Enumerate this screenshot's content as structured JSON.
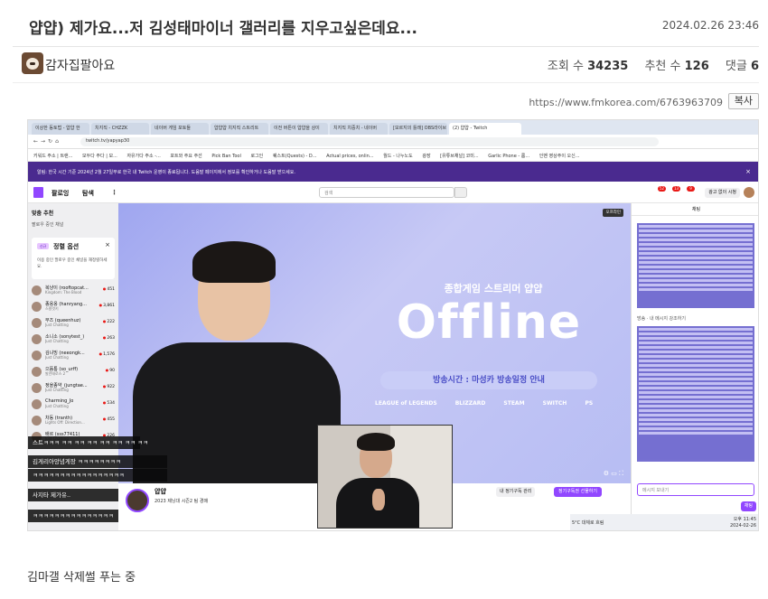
{
  "post": {
    "title": "얍얍) 제가요...저 김성태마이너 갤러리를 지우고싶은데요...",
    "date": "2024.02.26 23:46",
    "author": "감자집팔아요",
    "views_label": "조회 수",
    "views": "34235",
    "recommend_label": "추천 수",
    "recommend": "126",
    "comments_label": "댓글",
    "comments": "6",
    "url": "https://www.fmkorea.com/6763963709",
    "copy_label": "복사",
    "caption": "김마갤 삭제썰 푸는 중"
  },
  "browser": {
    "tabs": [
      "이상한 동토법 - 얍얍 한",
      "치지직 - CHZZK",
      "네이버 게임 포토들",
      "얍얍얍 치지직 스트리트",
      "이전 버튼이 얍얍을 상이",
      "치지직 치중치 - 네이버",
      "[모르지의 틀래] OBS라이브",
      "(2) 얍얍 - Twitch"
    ],
    "url": "twitch.tv/yapyap30",
    "bookmarks": [
      "키워드 주소 | 트랜...",
      "모두다 주다 | 모...",
      "자유가다 주소 -...",
      "포트와 주요 주선",
      "Pick Ban Tool",
      "로그인",
      "퀘스트(Quests) - D...",
      "Actual prices, onlin...",
      "월드 - 나누노도",
      "광장",
      "[유튜브채널] 코미...",
      "Garlic Phone - 룸...",
      "인벤 영상주이 오신..."
    ]
  },
  "twitch": {
    "notice": "알림: 한국 시간 기준 2024년 2월 27일부로 한국 내 Twitch 운영이 종료됩니다. 도움말 페이지에서 정보를 확인하거나 도움말 받으세요.",
    "nav_following": "팔로잉",
    "nav_browse": "탐색",
    "search_placeholder": "검색",
    "ad_free": "광고 없이 시청",
    "notif_counts": [
      "52",
      "13",
      "9"
    ],
    "sidebar_title": "맞춤 추천",
    "sidebar_sub": "팔로우 중인 채널",
    "card_tag": "신규",
    "card_title": "정렬 옵션",
    "card_desc": "이용 중인 팔로우 중인 채널을 재정렬하세요.",
    "channels": [
      {
        "name": "복냥이 (rooftopcat...",
        "game": "Kingdom: The Blood",
        "viewers": "451"
      },
      {
        "name": "종옹옹 (hanryang...",
        "game": "스팔럿키",
        "viewers": "3,861"
      },
      {
        "name": "무즈 (queenhuz)",
        "game": "Just Chatting",
        "viewers": "222"
      },
      {
        "name": "소니소 (sonytest_)",
        "game": "Just Chatting",
        "viewers": "263"
      },
      {
        "name": "김냐빙 (neeongk...",
        "game": "Just Chatting",
        "viewers": "1,576"
      },
      {
        "name": "으뜸통 (so_urff)",
        "game": "발란태로스 2",
        "viewers": "90"
      },
      {
        "name": "정을종약_(jungtae...",
        "game": "Just Chatting",
        "viewers": "922"
      },
      {
        "name": "Charming_Jo",
        "game": "Just Chatting",
        "viewers": "534"
      },
      {
        "name": "차동 (tranth)",
        "game": "Lights Off: Direction...",
        "viewers": "455"
      },
      {
        "name": "배르 (sss77411)",
        "game": "Just Chatting",
        "viewers": "226"
      }
    ],
    "offline_label": "오프라인",
    "headline": "종합게임 스트리머 얍얍",
    "offline_text": "Offline",
    "schedule": "방송시간 : 마성카 방송일정 안내",
    "platform_logos": [
      "LEAGUE of LEGENDS",
      "BLIZZARD",
      "STEAM",
      "SWITCH",
      "PS"
    ],
    "chat_overlays": [
      "스트ㅋㅋㅋ ㅋㅋ ㅋㅋ ㅋㅋ ㅋㅋ ㅋㅋ ㅋㅋ ㅋㅋ",
      "김게리아앙념게장 ㅋㅋㅋㅋㅋㅋㅋㅋ",
      "ㅋㅋㅋㅋㅋㅋㅋㅋㅋㅋㅋㅋㅋㅋㅋㅋㅋ",
      "사지타 제가유..",
      "ㅋㅋㅋㅋㅋㅋㅋㅋㅋㅋㅋㅋㅋㅋㅋ"
    ],
    "channel_name": "얍얍",
    "channel_title": "2023 제닝대 시즌2 팀 경매",
    "follow_label": "내 정기구독 관리",
    "sub_label": "정기구독권 선물하기",
    "chat_header": "채팅",
    "chat_mid": "방송 · 내 메시지 강조하기",
    "chat_placeholder": "메시지 보내기",
    "chat_send": "채팅",
    "weather": "5°C 대체로 흐림",
    "clock_time": "오후 11:45",
    "clock_date": "2024-02-26"
  }
}
